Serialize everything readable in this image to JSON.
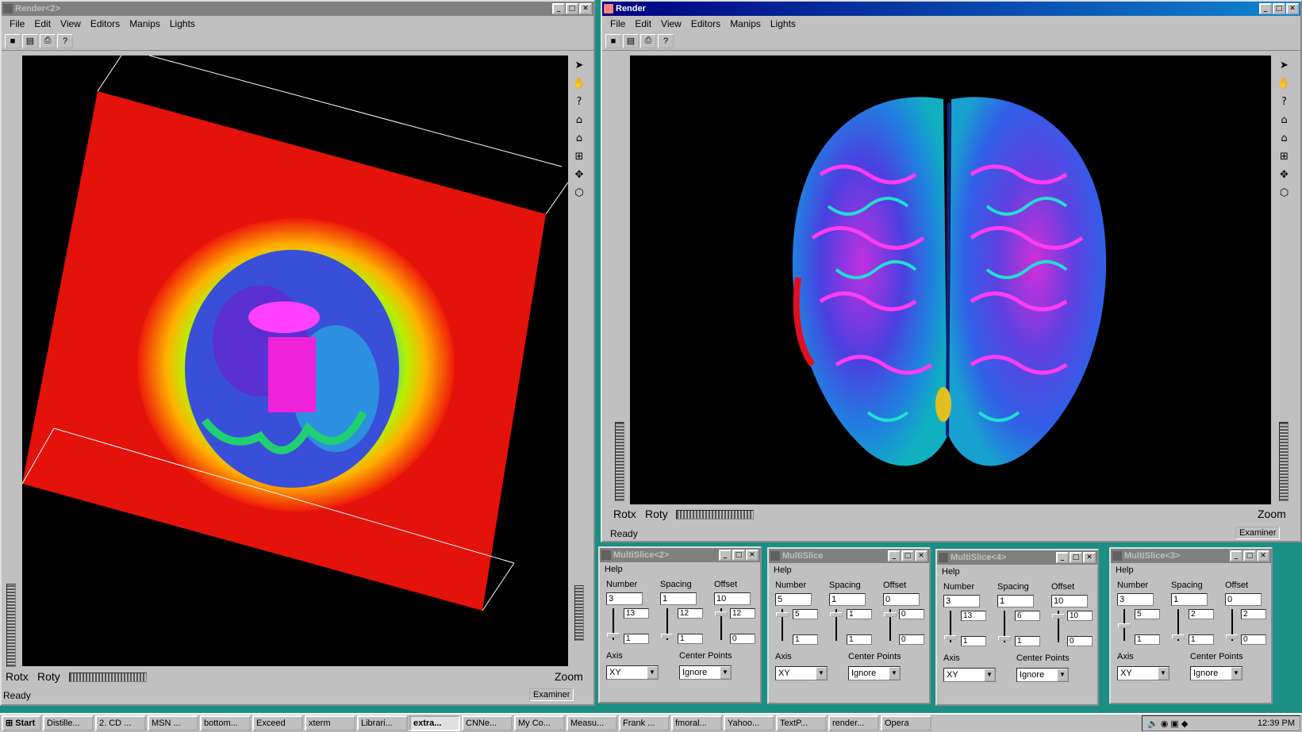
{
  "left_window": {
    "title": "Render<2>",
    "menu": [
      "File",
      "Edit",
      "View",
      "Editors",
      "Manips",
      "Lights"
    ],
    "rotx": "Rotx",
    "roty": "Roty",
    "zoom": "Zoom",
    "status": "Ready",
    "mode": "Examiner"
  },
  "right_window": {
    "title": "Render",
    "menu": [
      "File",
      "Edit",
      "View",
      "Editors",
      "Manips",
      "Lights"
    ],
    "rotx": "Rotx",
    "roty": "Roty",
    "zoom": "Zoom",
    "status": "Ready",
    "mode": "Examiner"
  },
  "multislice_common": {
    "help": "Help",
    "number": "Number",
    "spacing": "Spacing",
    "offset": "Offset",
    "axis": "Axis",
    "center_points": "Center Points"
  },
  "multislice": [
    {
      "title": "MultiSlice<2>",
      "number": "3",
      "spacing": "1",
      "offset": "10",
      "num_max": "13",
      "num_min": "1",
      "sp_max": "12",
      "sp_min": "1",
      "off_max": "12",
      "off_min": "0",
      "axis": "XY",
      "center": "Ignore"
    },
    {
      "title": "MultiSlice",
      "number": "5",
      "spacing": "1",
      "offset": "0",
      "num_max": "5",
      "num_min": "1",
      "sp_max": "1",
      "sp_min": "1",
      "off_max": "0",
      "off_min": "0",
      "axis": "XY",
      "center": "Ignore"
    },
    {
      "title": "MultiSlice<4>",
      "number": "3",
      "spacing": "1",
      "offset": "10",
      "num_max": "13",
      "num_min": "1",
      "sp_max": "6",
      "sp_min": "1",
      "off_max": "10",
      "off_min": "0",
      "axis": "XY",
      "center": "Ignore"
    },
    {
      "title": "MultiSlice<3>",
      "number": "3",
      "spacing": "1",
      "offset": "0",
      "num_max": "5",
      "num_min": "1",
      "sp_max": "2",
      "sp_min": "1",
      "off_max": "2",
      "off_min": "0",
      "axis": "XY",
      "center": "Ignore"
    }
  ],
  "taskbar": {
    "start": "Start",
    "tasks": [
      "Distille...",
      "2. CD ...",
      "MSN ...",
      "bottom...",
      "Exceed",
      "xterm",
      "Librari...",
      "extra...",
      "CNNe...",
      "My Co...",
      "Measu...",
      "Frank ...",
      "fmoral...",
      "Yahoo...",
      "TextP...",
      "render...",
      "Opera"
    ],
    "active_index": 7,
    "clock": "12:39 PM"
  }
}
